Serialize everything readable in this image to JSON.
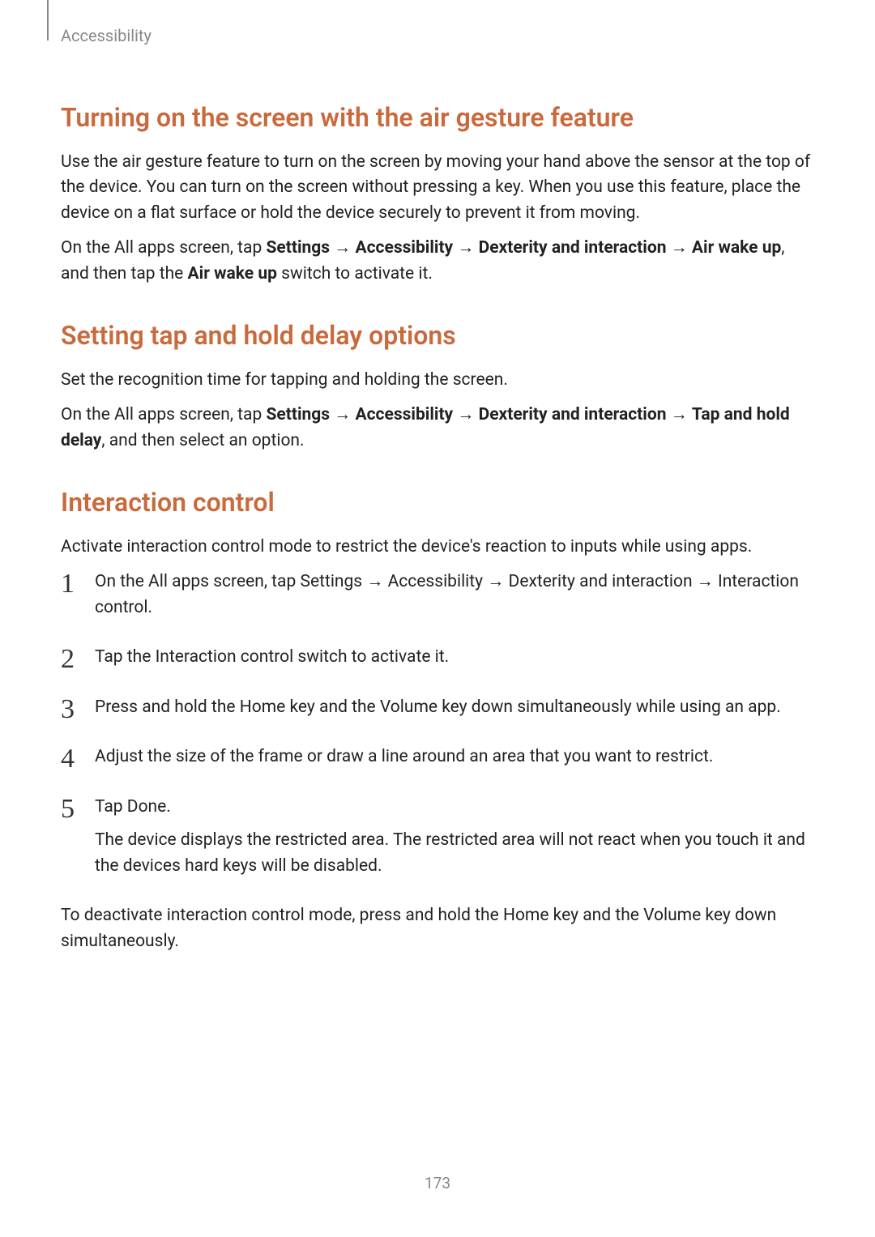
{
  "header": {
    "breadcrumb": "Accessibility"
  },
  "sections": {
    "s1": {
      "heading": "Turning on the screen with the air gesture feature",
      "p1": "Use the air gesture feature to turn on the screen by moving your hand above the sensor at the top of the device. You can turn on the screen without pressing a key. When you use this feature, place the device on a flat surface or hold the device securely to prevent it from moving.",
      "p2_1": "On the All apps screen, tap ",
      "p2_b1": "Settings",
      "p2_arr": " → ",
      "p2_b2": "Accessibility",
      "p2_b3": "Dexterity and interaction",
      "p2_b4": "Air wake up",
      "p2_2": ", and then tap the ",
      "p2_b5": "Air wake up",
      "p2_3": " switch to activate it."
    },
    "s2": {
      "heading": "Setting tap and hold delay options",
      "p1": "Set the recognition time for tapping and holding the screen.",
      "p2_1": "On the All apps screen, tap ",
      "p2_b1": "Settings",
      "p2_arr": " → ",
      "p2_b2": "Accessibility",
      "p2_b3": "Dexterity and interaction",
      "p2_b4": "Tap and hold delay",
      "p2_2": ", and then select an option."
    },
    "s3": {
      "heading": "Interaction control",
      "p1": "Activate interaction control mode to restrict the device's reaction to inputs while using apps.",
      "steps": {
        "st1_1": "On the All apps screen, tap ",
        "st1_b1": "Settings",
        "st1_arr": " → ",
        "st1_b2": "Accessibility",
        "st1_b3": "Dexterity and interaction",
        "st1_b4": "Interaction control",
        "st1_2": ".",
        "st2_1": "Tap the ",
        "st2_b1": "Interaction control",
        "st2_2": " switch to activate it.",
        "st3": "Press and hold the Home key and the Volume key down simultaneously while using an app.",
        "st4": "Adjust the size of the frame or draw a line around an area that you want to restrict.",
        "st5_1": "Tap ",
        "st5_b1": "Done",
        "st5_2": ".",
        "st5_sub": "The device displays the restricted area. The restricted area will not react when you touch it and the devices hard keys will be disabled."
      },
      "p_end": "To deactivate interaction control mode, press and hold the Home key and the Volume key down simultaneously."
    }
  },
  "pageNumber": "173"
}
